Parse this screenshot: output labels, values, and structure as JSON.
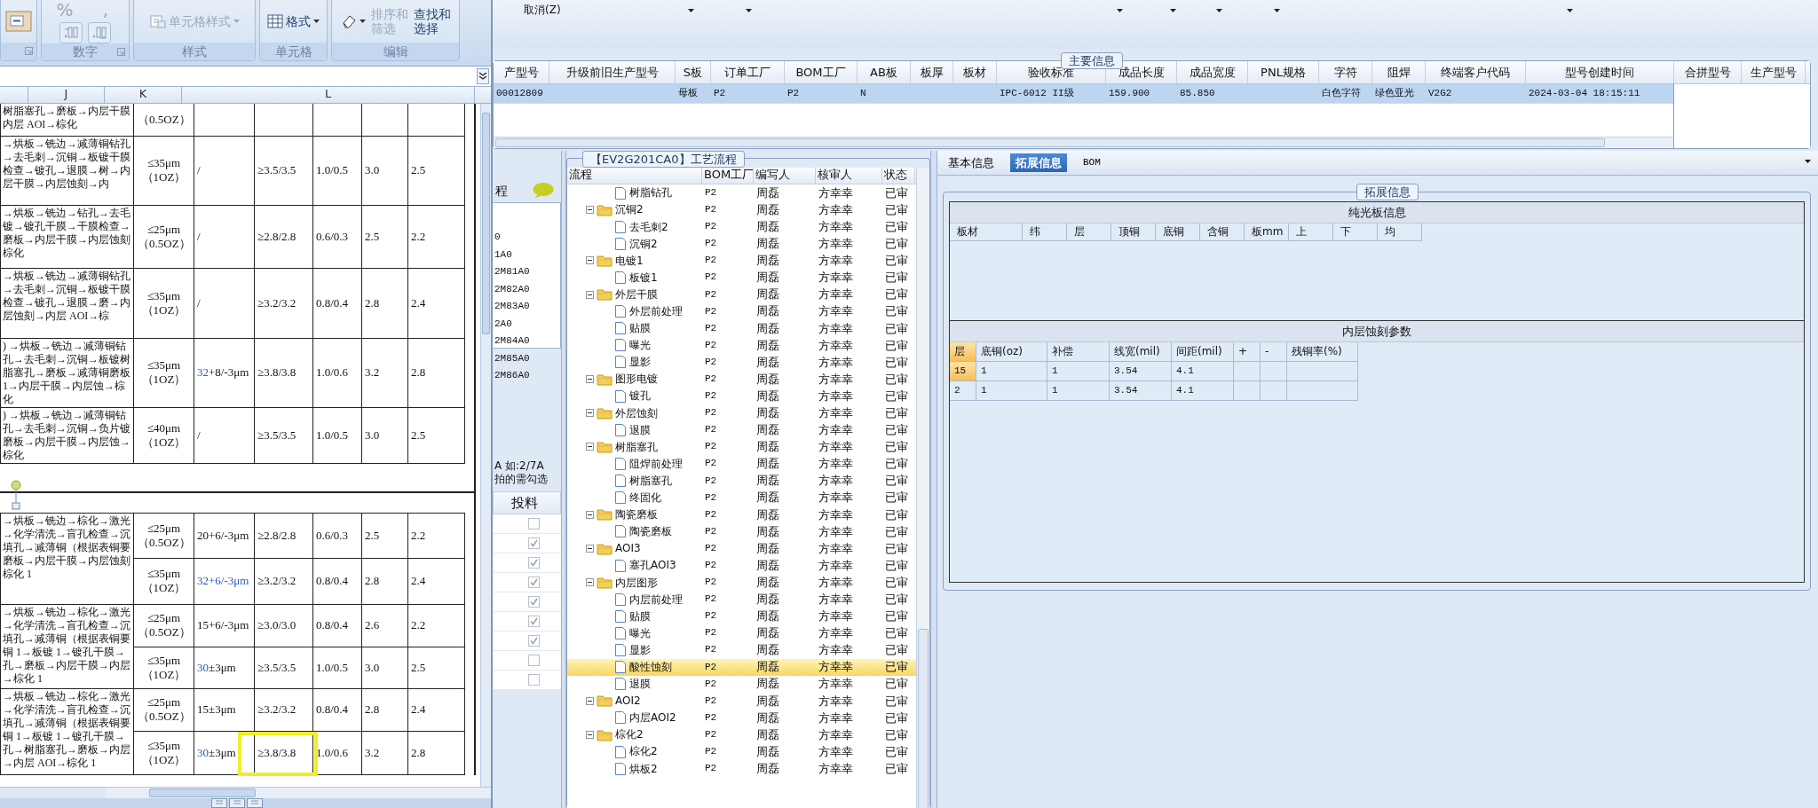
{
  "spreadsheet": {
    "ribbon": {
      "groups": [
        {
          "launcher": true,
          "buttons": [
            {
              "kind": "wrap"
            }
          ]
        },
        {
          "label": "数字",
          "launcher": true,
          "buttons": [
            {
              "kind": "glyph",
              "label": "%",
              "disabled": true
            },
            {
              "kind": "glyph",
              "label": ",",
              "disabled": true
            },
            {
              "kind": "decimal-increase"
            },
            {
              "kind": "decimal-decrease"
            }
          ]
        },
        {
          "label": "样式",
          "launcher": false,
          "buttons": [
            {
              "kind": "style",
              "label": "单元格样式",
              "disabled": true
            }
          ]
        },
        {
          "label": "单元格",
          "launcher": false,
          "buttons": [
            {
              "kind": "format",
              "label": "格式",
              "disabled": false
            }
          ]
        },
        {
          "label": "编辑",
          "launcher": false,
          "buttons": [
            {
              "kind": "clear"
            },
            {
              "kind": "sort",
              "label": "排序和筛选",
              "disabled": true
            },
            {
              "kind": "find",
              "label": "查找和选择",
              "disabled": false
            }
          ]
        }
      ]
    },
    "column_headers": [
      "J",
      "K",
      "L"
    ],
    "tables": [
      {
        "groups": [
          {
            "process": "树脂塞孔→磨板→内层干膜内层 AOI→棕化",
            "rows": [
              [
                "（0.5OZ）"
              ]
            ]
          },
          {
            "process": "→烘板→铣边→减薄铜钻孔→去毛刺→沉铜→板镀干膜检查→镀孔→退膜→树→内层干膜→内层蚀刻→内",
            "rows": [
              [
                "≤35μm（1OZ）",
                "/",
                "≥3.5/3.5",
                "1.0/0.5",
                "3.0",
                "2.5"
              ]
            ]
          },
          {
            "process": "→烘板→铣边→钻孔→去毛镀→镀孔干膜→干膜检查→磨板→内层干膜→内层蚀刻棕化",
            "rows": [
              [
                "≤25μm（0.5OZ）",
                "/",
                "≥2.8/2.8",
                "0.6/0.3",
                "2.5",
                "2.2"
              ]
            ]
          },
          {
            "process": "→烘板→铣边→减薄铜钻孔→去毛刺→沉铜→板镀干膜检查→镀孔→退膜→磨→内层蚀刻→内层 AOI→棕",
            "rows": [
              [
                "≤35μm（1OZ）",
                "/",
                "≥3.2/3.2",
                "0.8/0.4",
                "2.8",
                "2.4"
              ]
            ]
          },
          {
            "process": ") →烘板→铣边→减薄铜钻孔→去毛刺→沉铜→板镀树脂塞孔→磨板→减薄铜磨板 1→内层干膜→内层蚀→棕化",
            "rows": [
              [
                "≤35μm（1OZ）",
                {
                  "parts": [
                    {
                      "text": "32",
                      "color": "#2b55b5"
                    },
                    {
                      "text": "+8/-3μm"
                    }
                  ]
                },
                "≥3.8/3.8",
                "1.0/0.6",
                "3.2",
                "2.8"
              ]
            ]
          },
          {
            "process": ") →烘板→铣边→减薄铜钻孔→去毛刺→沉铜→负片镀磨板→内层干膜→内层蚀→棕化",
            "rows": [
              [
                "≤40μm（1OZ）",
                "/",
                "≥3.5/3.5",
                "1.0/0.5",
                "3.0",
                "2.5"
              ]
            ]
          }
        ]
      },
      {
        "groups": [
          {
            "process": "→烘板→铣边→棕化→激光→化学清洗→盲孔检查→沉填孔→减薄铜（根据表铜要磨板→内层干膜→内层蚀刻棕化 1",
            "rows": [
              [
                "≤25μm（0.5OZ）",
                "20+6/-3μm",
                "≥2.8/2.8",
                "0.6/0.3",
                "2.5",
                "2.2"
              ],
              [
                "≤35μm（1OZ）",
                {
                  "parts": [
                    {
                      "text": "32+6/-3μm",
                      "color": "#2b55b5"
                    }
                  ]
                },
                "≥3.2/3.2",
                "0.8/0.4",
                "2.8",
                "2.4"
              ]
            ]
          },
          {
            "process": "→烘板→铣边→棕化→激光→化学清洗→盲孔检查→沉填孔→减薄铜（根据表铜要铜 1→板镀 1→镀孔干膜→孔→磨板→内层干膜→内层→棕化 1",
            "rows": [
              [
                "≤25μm（0.5OZ）",
                "15+6/-3μm",
                "≥3.0/3.0",
                "0.8/0.4",
                "2.6",
                "2.2"
              ],
              [
                "≤35μm（1OZ）",
                {
                  "parts": [
                    {
                      "text": "30",
                      "color": "#2b55b5"
                    },
                    {
                      "text": "±3μm"
                    }
                  ]
                },
                "≥3.5/3.5",
                "1.0/0.5",
                "3.0",
                "2.5"
              ]
            ]
          },
          {
            "process": "→烘板→铣边→棕化→激光→化学清洗→盲孔检查→沉填孔→减薄铜（根据表铜要铜 1→板镀 1→镀孔干膜→孔→树脂塞孔→磨板→内层→内层 AOI→棕化 1",
            "rows": [
              [
                "≤25μm（0.5OZ）",
                "15±3μm",
                "≥3.2/3.2",
                "0.8/0.4",
                "2.8",
                "2.4"
              ],
              [
                "≤35μm（1OZ）",
                {
                  "parts": [
                    {
                      "text": "30",
                      "color": "#2b55b5"
                    },
                    {
                      "text": "±3μm"
                    }
                  ]
                },
                "≥3.8/3.8",
                "1.0/0.6",
                "3.2",
                "2.8"
              ]
            ]
          }
        ]
      }
    ]
  },
  "toolbar": {
    "cancel_label": "取消(Z)",
    "dropdowns": [
      {
        "kind": "dropdown"
      },
      {
        "kind": "dropdown"
      },
      {
        "kind": "dropdown"
      },
      {
        "kind": "dropdown"
      },
      {
        "kind": "dropdown"
      },
      {
        "kind": "dropdown"
      },
      {
        "kind": "dropdown"
      }
    ]
  },
  "main_info": {
    "title": "主要信息",
    "columns": [
      "产型号",
      "升级前旧生产型号",
      "S板",
      "订单工厂",
      "BOM工厂",
      "AB板",
      "板厚",
      "板材",
      "验收标准",
      "成品长度",
      "成品宽度",
      "PNL规格",
      "字符",
      "阻焊",
      "终端客户代码",
      "型号创建时间"
    ],
    "rows": [
      {
        "selected": true,
        "cells": [
          "00012809",
          null,
          "母板",
          "P2",
          "P2",
          "N",
          null,
          null,
          "IPC-6012 II级",
          "159.900",
          "85.850",
          null,
          "白色字符",
          "绿色亚光",
          "V2G2",
          "2024-03-04 18:15:11"
        ]
      }
    ],
    "merge_columns": [
      "合拼型号",
      "生产型号"
    ]
  },
  "side_panel": {
    "label": "程",
    "codes": [
      "0",
      "1A0",
      "2M81A0",
      "2M82A0",
      "2M83A0",
      "2A0",
      "2M84A0",
      "2M85A0",
      "2M86A0"
    ],
    "hints": [
      "A 如:2/7A",
      "拍的需勾选"
    ],
    "column": "投料",
    "checks": [
      {
        "checked": false
      },
      {
        "checked": true
      },
      {
        "checked": true
      },
      {
        "checked": true
      },
      {
        "checked": true
      },
      {
        "checked": true
      },
      {
        "checked": true
      },
      {
        "checked": false
      },
      {
        "checked": false
      }
    ]
  },
  "process_tree": {
    "title": "【EV2G201CA0】工艺流程",
    "columns": [
      "流程",
      "BOM工厂",
      "编写人",
      "核审人",
      "状态"
    ],
    "nodes": [
      {
        "kind": "step",
        "label": "树脂钻孔",
        "bom": "P2",
        "writer": "周磊",
        "reviewer": "方幸幸",
        "status": "已审",
        "selected": false
      },
      {
        "kind": "group",
        "label": "沉铜2",
        "bom": "P2",
        "writer": "周磊",
        "reviewer": "方幸幸",
        "status": "已审",
        "selected": false,
        "expanded": true,
        "children": [
          {
            "kind": "step",
            "label": "去毛刺2",
            "bom": "P2",
            "writer": "周磊",
            "reviewer": "方幸幸",
            "status": "已审",
            "selected": false
          },
          {
            "kind": "step",
            "label": "沉铜2",
            "bom": "P2",
            "writer": "周磊",
            "reviewer": "方幸幸",
            "status": "已审",
            "selected": false
          }
        ]
      },
      {
        "kind": "group",
        "label": "电镀1",
        "bom": "P2",
        "writer": "周磊",
        "reviewer": "方幸幸",
        "status": "已审",
        "selected": false,
        "expanded": true,
        "children": [
          {
            "kind": "step",
            "label": "板镀1",
            "bom": "P2",
            "writer": "周磊",
            "reviewer": "方幸幸",
            "status": "已审",
            "selected": false
          }
        ]
      },
      {
        "kind": "group",
        "label": "外层干膜",
        "bom": "P2",
        "writer": "周磊",
        "reviewer": "方幸幸",
        "status": "已审",
        "selected": false,
        "expanded": true,
        "children": [
          {
            "kind": "step",
            "label": "外层前处理",
            "bom": "P2",
            "writer": "周磊",
            "reviewer": "方幸幸",
            "status": "已审",
            "selected": false
          },
          {
            "kind": "step",
            "label": "贴膜",
            "bom": "P2",
            "writer": "周磊",
            "reviewer": "方幸幸",
            "status": "已审",
            "selected": false
          },
          {
            "kind": "step",
            "label": "曝光",
            "bom": "P2",
            "writer": "周磊",
            "reviewer": "方幸幸",
            "status": "已审",
            "selected": false
          },
          {
            "kind": "step",
            "label": "显影",
            "bom": "P2",
            "writer": "周磊",
            "reviewer": "方幸幸",
            "status": "已审",
            "selected": false
          }
        ]
      },
      {
        "kind": "group",
        "label": "图形电镀",
        "bom": "P2",
        "writer": "周磊",
        "reviewer": "方幸幸",
        "status": "已审",
        "selected": false,
        "expanded": true,
        "children": [
          {
            "kind": "step",
            "label": "镀孔",
            "bom": "P2",
            "writer": "周磊",
            "reviewer": "方幸幸",
            "status": "已审",
            "selected": false
          }
        ]
      },
      {
        "kind": "group",
        "label": "外层蚀刻",
        "bom": "P2",
        "writer": "周磊",
        "reviewer": "方幸幸",
        "status": "已审",
        "selected": false,
        "expanded": true,
        "children": [
          {
            "kind": "step",
            "label": "退膜",
            "bom": "P2",
            "writer": "周磊",
            "reviewer": "方幸幸",
            "status": "已审",
            "selected": false
          }
        ]
      },
      {
        "kind": "group",
        "label": "树脂塞孔",
        "bom": "P2",
        "writer": "周磊",
        "reviewer": "方幸幸",
        "status": "已审",
        "selected": false,
        "expanded": true,
        "children": [
          {
            "kind": "step",
            "label": "阻焊前处理",
            "bom": "P2",
            "writer": "周磊",
            "reviewer": "方幸幸",
            "status": "已审",
            "selected": false
          },
          {
            "kind": "step",
            "label": "树脂塞孔",
            "bom": "P2",
            "writer": "周磊",
            "reviewer": "方幸幸",
            "status": "已审",
            "selected": false
          },
          {
            "kind": "step",
            "label": "终固化",
            "bom": "P2",
            "writer": "周磊",
            "reviewer": "方幸幸",
            "status": "已审",
            "selected": false
          }
        ]
      },
      {
        "kind": "group",
        "label": "陶瓷磨板",
        "bom": "P2",
        "writer": "周磊",
        "reviewer": "方幸幸",
        "status": "已审",
        "selected": false,
        "expanded": true,
        "children": [
          {
            "kind": "step",
            "label": "陶瓷磨板",
            "bom": "P2",
            "writer": "周磊",
            "reviewer": "方幸幸",
            "status": "已审",
            "selected": false
          }
        ]
      },
      {
        "kind": "group",
        "label": "AOI3",
        "bom": "P2",
        "writer": "周磊",
        "reviewer": "方幸幸",
        "status": "已审",
        "selected": false,
        "expanded": true,
        "children": [
          {
            "kind": "step",
            "label": "塞孔AOI3",
            "bom": "P2",
            "writer": "周磊",
            "reviewer": "方幸幸",
            "status": "已审",
            "selected": false
          }
        ]
      },
      {
        "kind": "group",
        "label": "内层图形",
        "bom": "P2",
        "writer": "周磊",
        "reviewer": "方幸幸",
        "status": "已审",
        "selected": false,
        "expanded": true,
        "children": [
          {
            "kind": "step",
            "label": "内层前处理",
            "bom": "P2",
            "writer": "周磊",
            "reviewer": "方幸幸",
            "status": "已审",
            "selected": false
          },
          {
            "kind": "step",
            "label": "贴膜",
            "bom": "P2",
            "writer": "周磊",
            "reviewer": "方幸幸",
            "status": "已审",
            "selected": false
          },
          {
            "kind": "step",
            "label": "曝光",
            "bom": "P2",
            "writer": "周磊",
            "reviewer": "方幸幸",
            "status": "已审",
            "selected": false
          },
          {
            "kind": "step",
            "label": "显影",
            "bom": "P2",
            "writer": "周磊",
            "reviewer": "方幸幸",
            "status": "已审",
            "selected": false
          },
          {
            "kind": "step",
            "label": "酸性蚀刻",
            "bom": "P2",
            "writer": "周磊",
            "reviewer": "方幸幸",
            "status": "已审",
            "selected": true
          },
          {
            "kind": "step",
            "label": "退膜",
            "bom": "P2",
            "writer": "周磊",
            "reviewer": "方幸幸",
            "status": "已审",
            "selected": false
          }
        ]
      },
      {
        "kind": "group",
        "label": "AOI2",
        "bom": "P2",
        "writer": "周磊",
        "reviewer": "方幸幸",
        "status": "已审",
        "selected": false,
        "expanded": true,
        "children": [
          {
            "kind": "step",
            "label": "内层AOI2",
            "bom": "P2",
            "writer": "周磊",
            "reviewer": "方幸幸",
            "status": "已审",
            "selected": false
          }
        ]
      },
      {
        "kind": "group",
        "label": "棕化2",
        "bom": "P2",
        "writer": "周磊",
        "reviewer": "方幸幸",
        "status": "已审",
        "selected": false,
        "expanded": true,
        "children": [
          {
            "kind": "step",
            "label": "棕化2",
            "bom": "P2",
            "writer": "周磊",
            "reviewer": "方幸幸",
            "status": "已审",
            "selected": false
          },
          {
            "kind": "step",
            "label": "烘板2",
            "bom": "P2",
            "writer": "周磊",
            "reviewer": "方幸幸",
            "status": "已审",
            "selected": false
          }
        ]
      }
    ]
  },
  "detail": {
    "tabs": [
      {
        "label": "基本信息",
        "selected": false
      },
      {
        "label": "拓展信息",
        "selected": true
      },
      {
        "label": "BOM",
        "selected": false
      }
    ],
    "frame_title": "拓展信息",
    "bare_board": {
      "title": "纯光板信息",
      "columns": [
        "板材",
        "纬",
        "层",
        "顶铜",
        "底铜",
        "含铜",
        "板mm",
        "上",
        "下",
        "均"
      ]
    },
    "inner_etch": {
      "title": "内层蚀刻参数",
      "columns": [
        "层",
        "底铜(oz)",
        "补偿",
        "线宽(mil)",
        "间距(mil)",
        "+",
        "-",
        "残铜率(%)"
      ],
      "rows": [
        {
          "selected": true,
          "cells": [
            "15",
            "1",
            "1",
            "3.54",
            "4.1"
          ]
        },
        {
          "selected": false,
          "cells": [
            "2",
            "1",
            "1",
            "3.54",
            "4.1"
          ]
        }
      ]
    }
  }
}
